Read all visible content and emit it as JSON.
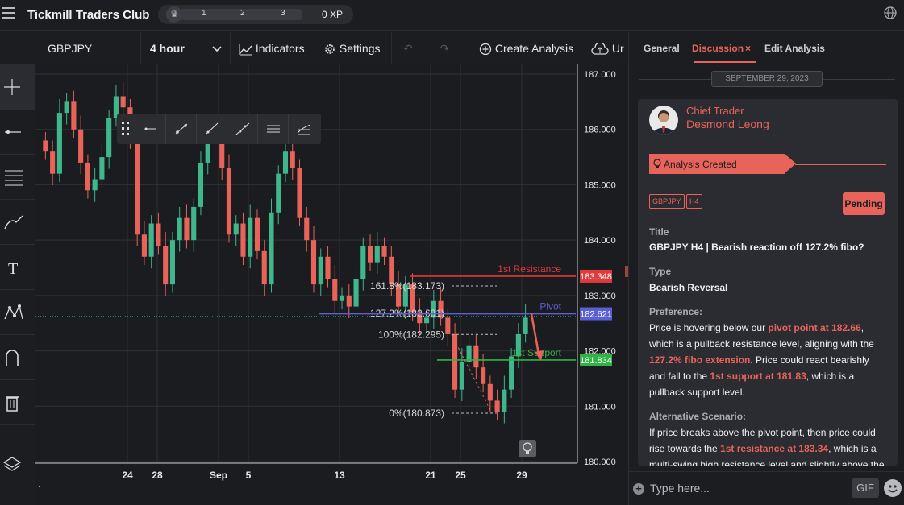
{
  "app": {
    "title": "Tickmill Traders Club",
    "xp_levels": [
      "1",
      "2",
      "3"
    ],
    "xp_value": "0 XP"
  },
  "toolbar": {
    "symbol": "GBPJPY",
    "timeframe": "4 hour",
    "indicators_label": "Indicators",
    "settings_label": "Settings",
    "create_analysis_label": "Create Analysis",
    "upload_label": "Ur"
  },
  "chart_data": {
    "type": "candlestick",
    "instrument": "GBPJPY",
    "timeframe": "4 hour",
    "y_ticks": [
      "187.000",
      "186.000",
      "185.000",
      "184.000",
      "183.000",
      "182.000",
      "181.000",
      "180.000"
    ],
    "ylim": [
      180.0,
      187.0
    ],
    "x_ticks": [
      "24",
      "28",
      "Sep",
      "5",
      "13",
      "21",
      "25",
      "29"
    ],
    "levels": [
      {
        "name": "1st Resistance",
        "value": 183.348,
        "price_label": "183.348",
        "color": "#e03a3a"
      },
      {
        "name": "Pivot",
        "value": 182.67,
        "price_label": "182.621",
        "color": "#5a5fd6"
      },
      {
        "name": "1st Support",
        "value": 181.834,
        "price_label": "181.834",
        "color": "#2fb344"
      }
    ],
    "fib_levels": [
      {
        "label": "161.8%(183.173)",
        "value": 183.173
      },
      {
        "label": "127.2%(182.681)",
        "value": 182.681
      },
      {
        "label": "100%(182.295)",
        "value": 182.295
      },
      {
        "label": "0%(180.873)",
        "value": 180.873
      }
    ],
    "current_price": 182.621,
    "closes": [
      185.6,
      185.2,
      186.3,
      186.5,
      186.0,
      185.4,
      184.9,
      185.1,
      185.5,
      186.2,
      186.6,
      186.4,
      185.8,
      184.1,
      183.7,
      184.3,
      183.9,
      183.2,
      184.0,
      184.4,
      184.0,
      184.6,
      185.4,
      185.9,
      186.0,
      185.3,
      184.1,
      184.3,
      183.7,
      184.4,
      183.8,
      183.2,
      184.5,
      185.2,
      185.6,
      185.3,
      184.4,
      184.0,
      183.2,
      183.7,
      183.3,
      182.9,
      183.0,
      182.8,
      183.3,
      183.9,
      183.6,
      183.9,
      183.7,
      183.2,
      182.8,
      183.2,
      182.7,
      182.5,
      182.6,
      182.9,
      182.6,
      182.3,
      181.3,
      181.8,
      182.1,
      181.7,
      181.4,
      181.1,
      180.9,
      181.3,
      181.9,
      182.3,
      182.6
    ]
  },
  "panel": {
    "tabs": [
      "General",
      "Discussion",
      "Edit Analysis"
    ],
    "close_icon_glyph": "×",
    "date_separator": "SEPTEMBER 29, 2023",
    "author_role": "Chief Trader",
    "author_name": "Desmond Leong",
    "banner_label": "Analysis Created",
    "tags": [
      "GBPJPY",
      "H4"
    ],
    "status": "Pending",
    "title_label": "Title",
    "title_value": "GBPJPY H4 | Bearish reaction off 127.2% fibo?",
    "type_label": "Type",
    "type_value": "Bearish Reversal",
    "preference_label": "Preference:",
    "preference": [
      {
        "t": "Price is hovering below our ",
        "hl": false
      },
      {
        "t": "pivot point at 182.66",
        "hl": true
      },
      {
        "t": ", which is a pullback resistance level, aligning with the ",
        "hl": false
      },
      {
        "t": "127.2% fibo extension",
        "hl": true
      },
      {
        "t": ". Price could react bearishly and fall to the ",
        "hl": false
      },
      {
        "t": "1st support at 181.83",
        "hl": true
      },
      {
        "t": ", which is a pullback support level.",
        "hl": false
      }
    ],
    "alt_label": "Alternative Scenario:",
    "alternative": [
      {
        "t": "If price breaks above the pivot point, then price could rise towards the ",
        "hl": false
      },
      {
        "t": "1st resistance at 183.34",
        "hl": true
      },
      {
        "t": ", which is a multi-swing high resistance level and slightly above the",
        "hl": false
      }
    ],
    "composer_placeholder": "Type here...",
    "gif_label": "GIF"
  },
  "colors": {
    "accent": "#e8645a",
    "bull": "#3fb68b",
    "bear": "#e8645a",
    "resistance": "#e03a3a",
    "pivot": "#5a5fd6",
    "support": "#2fb344"
  }
}
